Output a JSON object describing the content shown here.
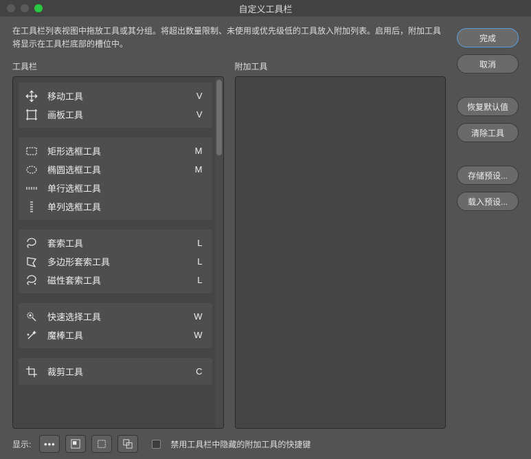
{
  "window": {
    "title": "自定义工具栏"
  },
  "description": "在工具栏列表视图中拖放工具或其分组。将超出数量限制、未使用或优先级低的工具放入附加列表。启用后，附加工具将显示在工具栏底部的槽位中。",
  "panels": {
    "toolbar_label": "工具栏",
    "extras_label": "附加工具"
  },
  "groups": [
    {
      "items": [
        {
          "icon": "move-icon",
          "name": "移动工具",
          "shortcut": "V"
        },
        {
          "icon": "artboard-icon",
          "name": "画板工具",
          "shortcut": "V"
        }
      ]
    },
    {
      "items": [
        {
          "icon": "rect-marquee-icon",
          "name": "矩形选框工具",
          "shortcut": "M"
        },
        {
          "icon": "ellipse-marquee-icon",
          "name": "椭圆选框工具",
          "shortcut": "M"
        },
        {
          "icon": "row-marquee-icon",
          "name": "单行选框工具",
          "shortcut": ""
        },
        {
          "icon": "col-marquee-icon",
          "name": "单列选框工具",
          "shortcut": ""
        }
      ]
    },
    {
      "items": [
        {
          "icon": "lasso-icon",
          "name": "套索工具",
          "shortcut": "L"
        },
        {
          "icon": "poly-lasso-icon",
          "name": "多边形套索工具",
          "shortcut": "L"
        },
        {
          "icon": "mag-lasso-icon",
          "name": "磁性套索工具",
          "shortcut": "L"
        }
      ]
    },
    {
      "items": [
        {
          "icon": "quick-select-icon",
          "name": "快速选择工具",
          "shortcut": "W"
        },
        {
          "icon": "magic-wand-icon",
          "name": "魔棒工具",
          "shortcut": "W"
        }
      ]
    },
    {
      "items": [
        {
          "icon": "crop-icon",
          "name": "裁剪工具",
          "shortcut": "C"
        }
      ]
    }
  ],
  "buttons": {
    "done": "完成",
    "cancel": "取消",
    "restore": "恢复默认值",
    "clear": "清除工具",
    "save_preset": "存储预设...",
    "load_preset": "载入预设..."
  },
  "bottom": {
    "show_label": "显示:",
    "checkbox_label": "禁用工具栏中隐藏的附加工具的快捷键"
  }
}
